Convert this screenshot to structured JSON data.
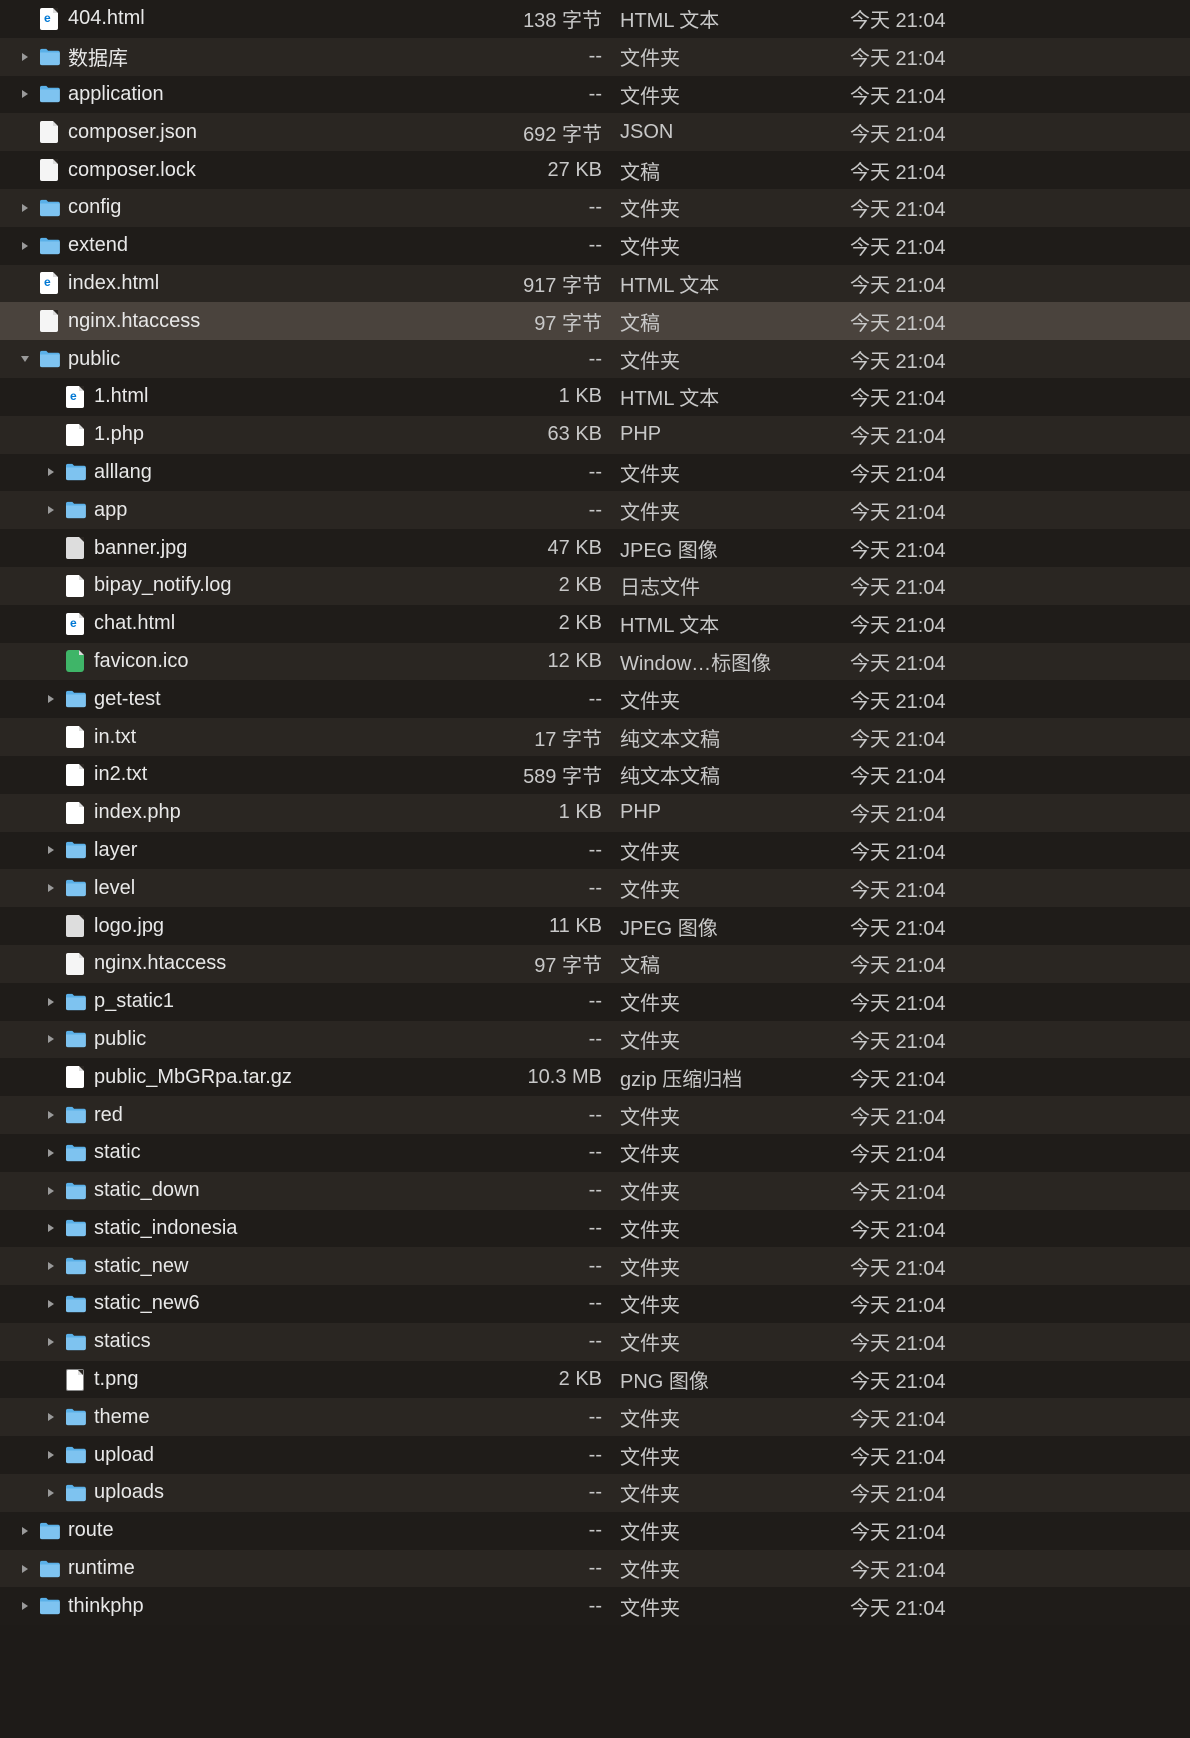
{
  "rows": [
    {
      "indent": 1,
      "arrow": null,
      "icon": "html",
      "name": "404.html",
      "size": "138 字节",
      "kind": "HTML 文本",
      "date": "今天 21:04",
      "sel": false
    },
    {
      "indent": 1,
      "arrow": "right",
      "icon": "folder",
      "name": "数据库",
      "size": "--",
      "kind": "文件夹",
      "date": "今天 21:04",
      "sel": false
    },
    {
      "indent": 1,
      "arrow": "right",
      "icon": "folder",
      "name": "application",
      "size": "--",
      "kind": "文件夹",
      "date": "今天 21:04",
      "sel": false
    },
    {
      "indent": 1,
      "arrow": null,
      "icon": "json",
      "name": "composer.json",
      "size": "692 字节",
      "kind": "JSON",
      "date": "今天 21:04",
      "sel": false
    },
    {
      "indent": 1,
      "arrow": null,
      "icon": "lock",
      "name": "composer.lock",
      "size": "27 KB",
      "kind": "文稿",
      "date": "今天 21:04",
      "sel": false
    },
    {
      "indent": 1,
      "arrow": "right",
      "icon": "folder",
      "name": "config",
      "size": "--",
      "kind": "文件夹",
      "date": "今天 21:04",
      "sel": false
    },
    {
      "indent": 1,
      "arrow": "right",
      "icon": "folder",
      "name": "extend",
      "size": "--",
      "kind": "文件夹",
      "date": "今天 21:04",
      "sel": false
    },
    {
      "indent": 1,
      "arrow": null,
      "icon": "html",
      "name": "index.html",
      "size": "917 字节",
      "kind": "HTML 文本",
      "date": "今天 21:04",
      "sel": false
    },
    {
      "indent": 1,
      "arrow": null,
      "icon": "htaccess",
      "name": "nginx.htaccess",
      "size": "97 字节",
      "kind": "文稿",
      "date": "今天 21:04",
      "sel": true
    },
    {
      "indent": 1,
      "arrow": "down",
      "icon": "folder",
      "name": "public",
      "size": "--",
      "kind": "文件夹",
      "date": "今天 21:04",
      "sel": false
    },
    {
      "indent": 2,
      "arrow": null,
      "icon": "html",
      "name": "1.html",
      "size": "1 KB",
      "kind": "HTML 文本",
      "date": "今天 21:04",
      "sel": false
    },
    {
      "indent": 2,
      "arrow": null,
      "icon": "php",
      "name": "1.php",
      "size": "63 KB",
      "kind": "PHP",
      "date": "今天 21:04",
      "sel": false
    },
    {
      "indent": 2,
      "arrow": "right",
      "icon": "folder",
      "name": "alllang",
      "size": "--",
      "kind": "文件夹",
      "date": "今天 21:04",
      "sel": false
    },
    {
      "indent": 2,
      "arrow": "right",
      "icon": "folder",
      "name": "app",
      "size": "--",
      "kind": "文件夹",
      "date": "今天 21:04",
      "sel": false
    },
    {
      "indent": 2,
      "arrow": null,
      "icon": "jpg",
      "name": "banner.jpg",
      "size": "47 KB",
      "kind": "JPEG 图像",
      "date": "今天 21:04",
      "sel": false
    },
    {
      "indent": 2,
      "arrow": null,
      "icon": "log",
      "name": "bipay_notify.log",
      "size": "2 KB",
      "kind": "日志文件",
      "date": "今天 21:04",
      "sel": false
    },
    {
      "indent": 2,
      "arrow": null,
      "icon": "html",
      "name": "chat.html",
      "size": "2 KB",
      "kind": "HTML 文本",
      "date": "今天 21:04",
      "sel": false
    },
    {
      "indent": 2,
      "arrow": null,
      "icon": "ico",
      "name": "favicon.ico",
      "size": "12 KB",
      "kind": "Window…标图像",
      "date": "今天 21:04",
      "sel": false
    },
    {
      "indent": 2,
      "arrow": "right",
      "icon": "folder",
      "name": "get-test",
      "size": "--",
      "kind": "文件夹",
      "date": "今天 21:04",
      "sel": false
    },
    {
      "indent": 2,
      "arrow": null,
      "icon": "txt",
      "name": "in.txt",
      "size": "17 字节",
      "kind": "纯文本文稿",
      "date": "今天 21:04",
      "sel": false
    },
    {
      "indent": 2,
      "arrow": null,
      "icon": "txt",
      "name": "in2.txt",
      "size": "589 字节",
      "kind": "纯文本文稿",
      "date": "今天 21:04",
      "sel": false
    },
    {
      "indent": 2,
      "arrow": null,
      "icon": "php",
      "name": "index.php",
      "size": "1 KB",
      "kind": "PHP",
      "date": "今天 21:04",
      "sel": false
    },
    {
      "indent": 2,
      "arrow": "right",
      "icon": "folder",
      "name": "layer",
      "size": "--",
      "kind": "文件夹",
      "date": "今天 21:04",
      "sel": false
    },
    {
      "indent": 2,
      "arrow": "right",
      "icon": "folder",
      "name": "level",
      "size": "--",
      "kind": "文件夹",
      "date": "今天 21:04",
      "sel": false
    },
    {
      "indent": 2,
      "arrow": null,
      "icon": "jpg",
      "name": "logo.jpg",
      "size": "11 KB",
      "kind": "JPEG 图像",
      "date": "今天 21:04",
      "sel": false
    },
    {
      "indent": 2,
      "arrow": null,
      "icon": "htaccess",
      "name": "nginx.htaccess",
      "size": "97 字节",
      "kind": "文稿",
      "date": "今天 21:04",
      "sel": false
    },
    {
      "indent": 2,
      "arrow": "right",
      "icon": "folder",
      "name": "p_static1",
      "size": "--",
      "kind": "文件夹",
      "date": "今天 21:04",
      "sel": false
    },
    {
      "indent": 2,
      "arrow": "right",
      "icon": "folder",
      "name": "public",
      "size": "--",
      "kind": "文件夹",
      "date": "今天 21:04",
      "sel": false
    },
    {
      "indent": 2,
      "arrow": null,
      "icon": "tar",
      "name": "public_MbGRpa.tar.gz",
      "size": "10.3 MB",
      "kind": "gzip 压缩归档",
      "date": "今天 21:04",
      "sel": false
    },
    {
      "indent": 2,
      "arrow": "right",
      "icon": "folder",
      "name": "red",
      "size": "--",
      "kind": "文件夹",
      "date": "今天 21:04",
      "sel": false
    },
    {
      "indent": 2,
      "arrow": "right",
      "icon": "folder",
      "name": "static",
      "size": "--",
      "kind": "文件夹",
      "date": "今天 21:04",
      "sel": false
    },
    {
      "indent": 2,
      "arrow": "right",
      "icon": "folder",
      "name": "static_down",
      "size": "--",
      "kind": "文件夹",
      "date": "今天 21:04",
      "sel": false
    },
    {
      "indent": 2,
      "arrow": "right",
      "icon": "folder",
      "name": "static_indonesia",
      "size": "--",
      "kind": "文件夹",
      "date": "今天 21:04",
      "sel": false
    },
    {
      "indent": 2,
      "arrow": "right",
      "icon": "folder",
      "name": "static_new",
      "size": "--",
      "kind": "文件夹",
      "date": "今天 21:04",
      "sel": false
    },
    {
      "indent": 2,
      "arrow": "right",
      "icon": "folder",
      "name": "static_new6",
      "size": "--",
      "kind": "文件夹",
      "date": "今天 21:04",
      "sel": false
    },
    {
      "indent": 2,
      "arrow": "right",
      "icon": "folder",
      "name": "statics",
      "size": "--",
      "kind": "文件夹",
      "date": "今天 21:04",
      "sel": false
    },
    {
      "indent": 2,
      "arrow": null,
      "icon": "png",
      "name": "t.png",
      "size": "2 KB",
      "kind": "PNG 图像",
      "date": "今天 21:04",
      "sel": false
    },
    {
      "indent": 2,
      "arrow": "right",
      "icon": "folder",
      "name": "theme",
      "size": "--",
      "kind": "文件夹",
      "date": "今天 21:04",
      "sel": false
    },
    {
      "indent": 2,
      "arrow": "right",
      "icon": "folder",
      "name": "upload",
      "size": "--",
      "kind": "文件夹",
      "date": "今天 21:04",
      "sel": false
    },
    {
      "indent": 2,
      "arrow": "right",
      "icon": "folder",
      "name": "uploads",
      "size": "--",
      "kind": "文件夹",
      "date": "今天 21:04",
      "sel": false
    },
    {
      "indent": 1,
      "arrow": "right",
      "icon": "folder",
      "name": "route",
      "size": "--",
      "kind": "文件夹",
      "date": "今天 21:04",
      "sel": false
    },
    {
      "indent": 1,
      "arrow": "right",
      "icon": "folder",
      "name": "runtime",
      "size": "--",
      "kind": "文件夹",
      "date": "今天 21:04",
      "sel": false
    },
    {
      "indent": 1,
      "arrow": "right",
      "icon": "folder",
      "name": "thinkphp",
      "size": "--",
      "kind": "文件夹",
      "date": "今天 21:04",
      "sel": false
    }
  ]
}
